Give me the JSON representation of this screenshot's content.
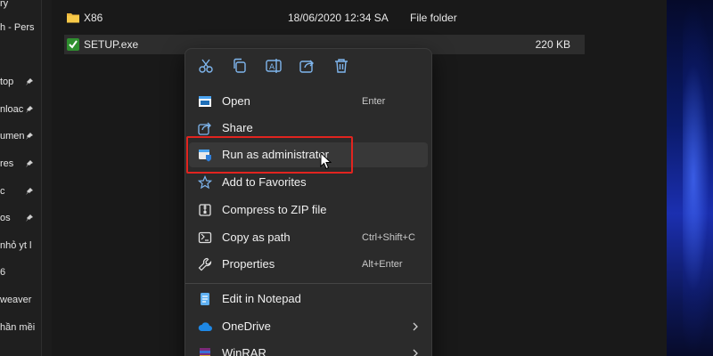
{
  "nav_pane": {
    "items": [
      {
        "text": "ry",
        "pinned": false
      },
      {
        "text": "h - Pers",
        "pinned": false
      },
      {
        "text": "top",
        "pinned": true
      },
      {
        "text": "nloac",
        "pinned": true
      },
      {
        "text": "umen",
        "pinned": true
      },
      {
        "text": "res",
        "pinned": true
      },
      {
        "text": "c",
        "pinned": true
      },
      {
        "text": "os",
        "pinned": true
      },
      {
        "text": "nhỏ yt l",
        "pinned": false
      },
      {
        "text": "6",
        "pinned": false
      },
      {
        "text": "weaver",
        "pinned": false
      },
      {
        "text": "hần mềi",
        "pinned": false
      }
    ]
  },
  "files": [
    {
      "name": "X86",
      "date": "18/06/2020 12:34 SA",
      "type": "File folder",
      "size": "",
      "icon": "folder-icon"
    },
    {
      "name": "SETUP.exe",
      "date": "",
      "type": "",
      "size": "220 KB",
      "icon": "exe-icon"
    }
  ],
  "context_menu": {
    "quick_actions": [
      "cut-icon",
      "copy-icon",
      "rename-icon",
      "share-icon",
      "delete-icon"
    ],
    "items": [
      {
        "label": "Open",
        "shortcut": "Enter",
        "icon": "open-icon"
      },
      {
        "label": "Share",
        "shortcut": "",
        "icon": "share-icon"
      },
      {
        "label": "Run as administrator",
        "shortcut": "",
        "icon": "admin-shield-icon"
      },
      {
        "label": "Add to Favorites",
        "shortcut": "",
        "icon": "star-icon"
      },
      {
        "label": "Compress to ZIP file",
        "shortcut": "",
        "icon": "zip-icon"
      },
      {
        "label": "Copy as path",
        "shortcut": "Ctrl+Shift+C",
        "icon": "copy-path-icon"
      },
      {
        "label": "Properties",
        "shortcut": "Alt+Enter",
        "icon": "wrench-icon"
      },
      {
        "label": "Edit in Notepad",
        "shortcut": "",
        "icon": "notepad-icon"
      },
      {
        "label": "OneDrive",
        "shortcut": "",
        "icon": "cloud-icon"
      },
      {
        "label": "WinRAR",
        "shortcut": "",
        "icon": "winrar-icon"
      }
    ]
  },
  "colors": {
    "highlight": "#e1241f",
    "accent": "#4aa3f0"
  }
}
